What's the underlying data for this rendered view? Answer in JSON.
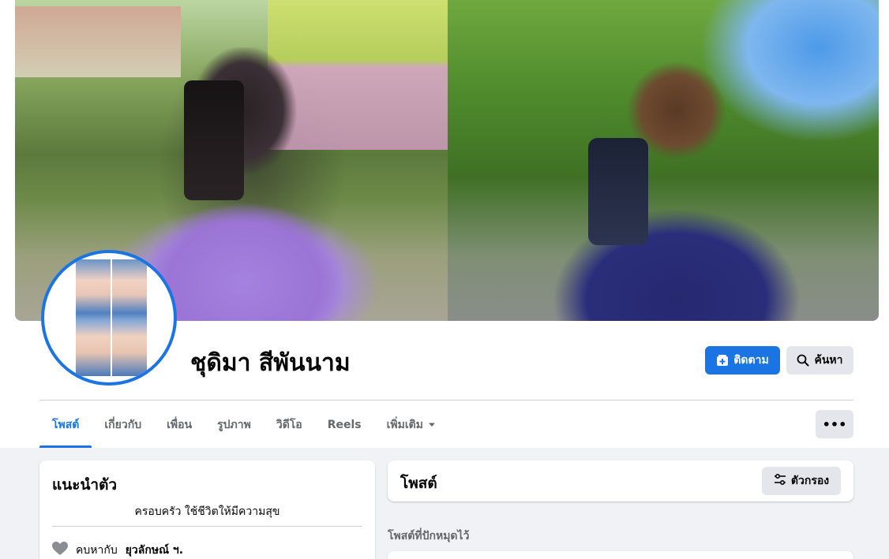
{
  "profile": {
    "name": "ชุดิมา สีพันนาม"
  },
  "actions": {
    "follow_label": "ติดตาม",
    "search_label": "ค้นหา",
    "more_label": "•••"
  },
  "tabs": [
    {
      "label": "โพสต์",
      "active": true
    },
    {
      "label": "เกี่ยวกับ",
      "active": false
    },
    {
      "label": "เพื่อน",
      "active": false
    },
    {
      "label": "รูปภาพ",
      "active": false
    },
    {
      "label": "วิดีโอ",
      "active": false
    },
    {
      "label": "Reels",
      "active": false
    },
    {
      "label": "เพิ่มเติม",
      "active": false,
      "has_dropdown": true
    }
  ],
  "intro": {
    "title": "แนะนำตัว",
    "bio": "ครอบครัว ใช้ชีวิตให้มีความสุข",
    "relationship_prefix": "คบหากับ",
    "relationship_partner": "ยุวลักษณ์ ฯ."
  },
  "posts": {
    "title": "โพสต์",
    "filter_label": "ตัวกรอง",
    "pinned_label": "โพสต์ที่ปักหมุดไว้"
  },
  "colors": {
    "accent": "#1b74e4",
    "button_gray": "#e4e6eb",
    "background": "#f0f2f5",
    "secondary_text": "#65676b"
  },
  "icons": {
    "follow": "follow-plus-icon",
    "search": "search-icon",
    "more_dropdown": "caret-down-icon",
    "filter": "filter-sliders-icon",
    "relationship": "heart-icon"
  }
}
